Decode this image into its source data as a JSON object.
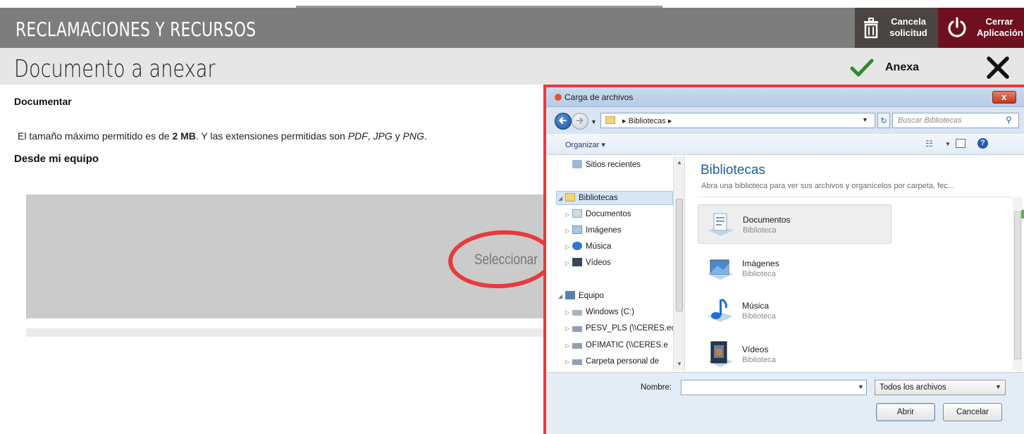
{
  "header": {
    "app_title": "RECLAMACIONES Y RECURSOS",
    "cancel_request_label": "Cancela solicitud",
    "close_app_label": "Cerrar Aplicación"
  },
  "subheader": {
    "page_title": "Documento a anexar",
    "annex_label": "Anexa"
  },
  "body": {
    "section_title": "Documentar",
    "info": {
      "prefix": "El tamaño máximo permitido es de ",
      "size": "2 MB",
      "middle": ". Y las extensiones permitidas son ",
      "ext1": "PDF",
      "sep1": ", ",
      "ext2": "JPG",
      "sep2": " y ",
      "ext3": "PNG",
      "suffix": "."
    },
    "from_label": "Desde mi equipo",
    "dropzone_text": "Seleccionar"
  },
  "dialog": {
    "title": "Carga de archivos",
    "close_label": "x",
    "address_crumb": "▸ Bibliotecas ▸",
    "search_placeholder": "Buscar Bibliotecas",
    "refresh_icon": "refresh-icon",
    "organize_label": "Organizar ▾",
    "nav": {
      "recent": "Sitios recientes",
      "libraries": "Bibliotecas",
      "documents": "Documentos",
      "images": "Imágenes",
      "music": "Música",
      "videos": "Vídeos",
      "computer": "Equipo",
      "drive_c": "Windows (C:)",
      "net1": "PESV_PLS (\\\\CERES.ec",
      "net2": "OFIMATIC (\\\\CERES.e",
      "personal": "Carpeta personal de"
    },
    "content": {
      "title": "Bibliotecas",
      "description": "Abra una biblioteca para ver sus archivos y organícelos por carpeta, fec...",
      "items": [
        {
          "name": "Documentos",
          "sub": "Biblioteca"
        },
        {
          "name": "Imágenes",
          "sub": "Biblioteca"
        },
        {
          "name": "Música",
          "sub": "Biblioteca"
        },
        {
          "name": "Vídeos",
          "sub": "Biblioteca"
        }
      ]
    },
    "filename_label": "Nombre:",
    "filename_value": "",
    "filter_value": "Todos los archivos",
    "open_label": "Abrir",
    "cancel_label": "Cancelar"
  },
  "colors": {
    "header_bg": "#7d7d7d",
    "close_app_bg": "#6f1020",
    "highlight_red": "#e83a3d",
    "check_green": "#2e8b2e"
  }
}
